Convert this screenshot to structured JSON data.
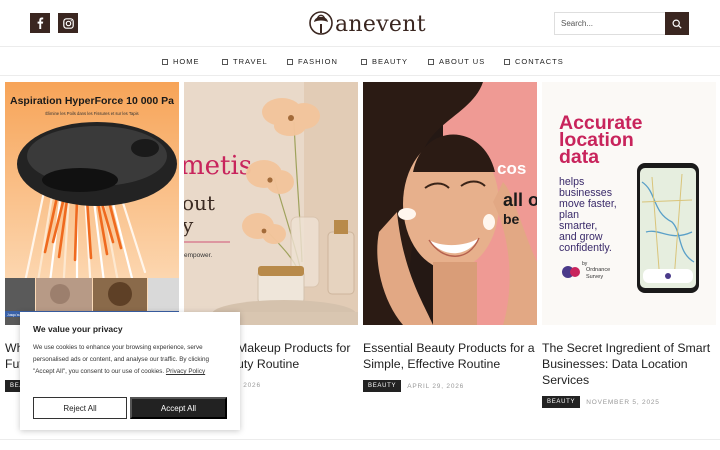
{
  "header": {
    "logo_text": "anevent",
    "search_placeholder": "Search...",
    "social": [
      "facebook-icon",
      "instagram-icon"
    ]
  },
  "nav": {
    "items": [
      {
        "label": "HOME"
      },
      {
        "label": "TRAVEL"
      },
      {
        "label": "FASHION"
      },
      {
        "label": "BEAUTY"
      },
      {
        "label": "ABOUT US"
      },
      {
        "label": "CONTACTS"
      }
    ]
  },
  "cards": [
    {
      "title": "Why Fut",
      "category": "BEAUTY",
      "date": "",
      "image": {
        "headline": "Aspiration HyperForce 10 000 Pa",
        "subline": "Élimine les Poils dans les Fissures et sur les Tapis",
        "captions": [
          "Jusqu'aux lignes",
          "Cheveux humains",
          "Nourriture pour animaux",
          "Céréales et miettes",
          "Pou"
        ]
      }
    },
    {
      "title": "Makeup Products for uty Routine",
      "category": "",
      "date": ", 2026",
      "image": {
        "brand_text": "metis",
        "line1": "out",
        "line2": "y",
        "tag": "empower."
      }
    },
    {
      "title": "Essential Beauty Products for a Simple, Effective Routine",
      "category": "BEAUTY",
      "date": "APRIL 29, 2026",
      "image": {
        "text1": "cos",
        "text2": "all o",
        "text3": "be"
      }
    },
    {
      "title": "The Secret Ingredient of Smart Businesses: Data Location Services",
      "category": "BEAUTY",
      "date": "NOVEMBER 5, 2025",
      "image": {
        "headline": [
          "Accurate",
          "location",
          "data"
        ],
        "body": [
          "helps",
          "businesses",
          "move faster,",
          "plan",
          "smarter,",
          "and grow",
          "confidently."
        ],
        "by": "by",
        "brand": [
          "Ordnance",
          "Survey"
        ]
      }
    }
  ],
  "cookie": {
    "title": "We value your privacy",
    "text": "We use cookies to enhance your browsing experience, serve personalised ads or content, and analyse our traffic. By clicking \"Accept All\", you consent to our use of cookies.",
    "link": "Privacy Policy",
    "reject": "Reject All",
    "accept": "Accept All"
  },
  "colors": {
    "brand": "#3a2620",
    "badge": "#222222",
    "accent_magenta": "#c8245c",
    "pink_bg": "#f0a09a"
  }
}
